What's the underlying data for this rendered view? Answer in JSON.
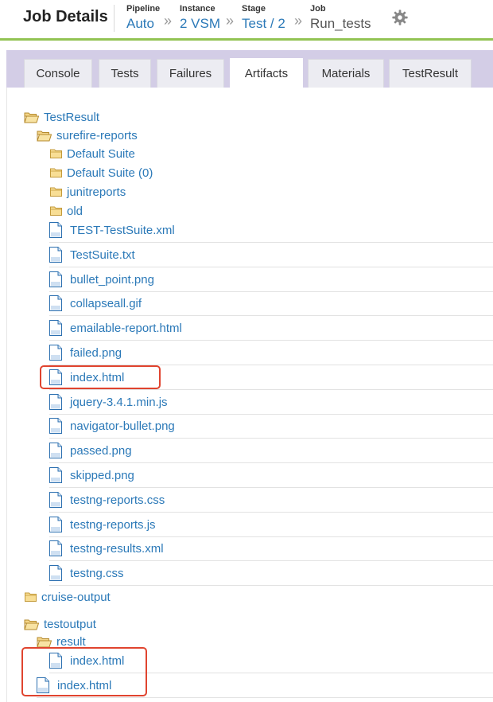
{
  "header": {
    "title": "Job Details",
    "breadcrumbs": [
      {
        "label": "Pipeline",
        "value": "Auto"
      },
      {
        "label": "Instance",
        "value": "2 VSM"
      },
      {
        "label": "Stage",
        "value": "Test / 2"
      },
      {
        "label": "Job",
        "value": "Run_tests"
      }
    ],
    "separator": "»",
    "settings_icon": "gear-icon"
  },
  "tabs": [
    "Console",
    "Tests",
    "Failures",
    "Artifacts",
    "Materials",
    "TestResult"
  ],
  "active_tab": "Artifacts",
  "tree": {
    "root1": "TestResult",
    "surefire": "surefire-reports",
    "subfolders": [
      "Default Suite",
      "Default Suite (0)",
      "junitreports",
      "old"
    ],
    "files": [
      "TEST-TestSuite.xml",
      "TestSuite.txt",
      "bullet_point.png",
      "collapseall.gif",
      "emailable-report.html",
      "failed.png",
      "index.html",
      "jquery-3.4.1.min.js",
      "navigator-bullet.png",
      "passed.png",
      "skipped.png",
      "testng-reports.css",
      "testng-reports.js",
      "testng-results.xml",
      "testng.css"
    ],
    "cruise": "cruise-output",
    "root2": "testoutput",
    "result": "result",
    "result_file": "index.html",
    "root2_file": "index.html"
  },
  "colors": {
    "link": "#2b79b8",
    "accent_line": "#92c353",
    "tab_bar": "#d3cde6",
    "highlight": "#e0442f"
  }
}
